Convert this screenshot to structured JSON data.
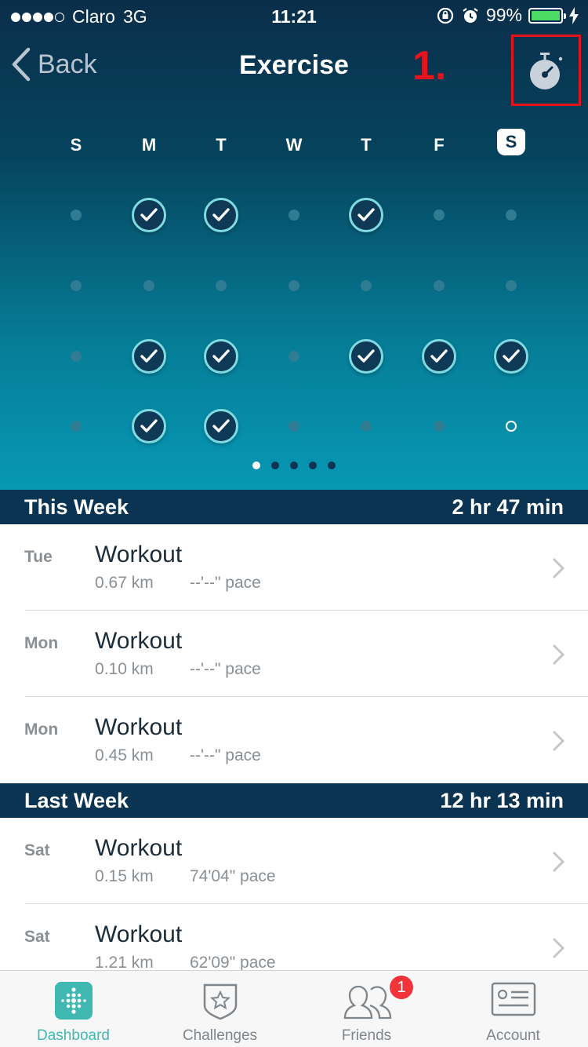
{
  "status_bar": {
    "carrier": "Claro",
    "network": "3G",
    "time": "11:21",
    "battery": "99%",
    "battery_level": 0.99
  },
  "nav": {
    "back_label": "Back",
    "title": "Exercise",
    "annotation": "1.",
    "timer_icon": "stopwatch-icon"
  },
  "calendar": {
    "days": [
      "S",
      "M",
      "T",
      "W",
      "T",
      "F",
      "S"
    ],
    "today_index": 6,
    "weeks": [
      [
        "dot",
        "check",
        "check",
        "dot",
        "check",
        "dot",
        "dot"
      ],
      [
        "dot",
        "dot",
        "dot",
        "dot",
        "dot",
        "dot",
        "dot"
      ],
      [
        "dot",
        "check",
        "check",
        "dot",
        "check",
        "check",
        "check"
      ],
      [
        "dot",
        "check",
        "check",
        "dot",
        "dot",
        "dot",
        "ring"
      ]
    ],
    "pages": 5,
    "active_page": 0
  },
  "this_week": {
    "title": "This Week",
    "total": "2 hr 47 min",
    "items": [
      {
        "day": "Tue",
        "name": "Workout",
        "distance": "0.67 km",
        "pace": "--'--\" pace"
      },
      {
        "day": "Mon",
        "name": "Workout",
        "distance": "0.10 km",
        "pace": "--'--\" pace"
      },
      {
        "day": "Mon",
        "name": "Workout",
        "distance": "0.45 km",
        "pace": "--'--\" pace"
      }
    ]
  },
  "last_week": {
    "title": "Last Week",
    "total": "12 hr 13 min",
    "items": [
      {
        "day": "Sat",
        "name": "Workout",
        "distance": "0.15 km",
        "pace": "74'04\" pace"
      },
      {
        "day": "Sat",
        "name": "Workout",
        "distance": "1.21 km",
        "pace": "62'09\" pace"
      }
    ]
  },
  "tabbar": {
    "tabs": [
      {
        "label": "Dashboard",
        "icon": "dashboard-icon",
        "active": true
      },
      {
        "label": "Challenges",
        "icon": "star-shield-icon",
        "active": false
      },
      {
        "label": "Friends",
        "icon": "friends-icon",
        "active": false
      },
      {
        "label": "Account",
        "icon": "id-card-icon",
        "active": false
      }
    ],
    "friends_badge": "1"
  },
  "colors": {
    "accent": "#3fb8b2",
    "navy": "#0b3452",
    "annotation_red": "#e3141b",
    "battery_green": "#4cd964"
  }
}
